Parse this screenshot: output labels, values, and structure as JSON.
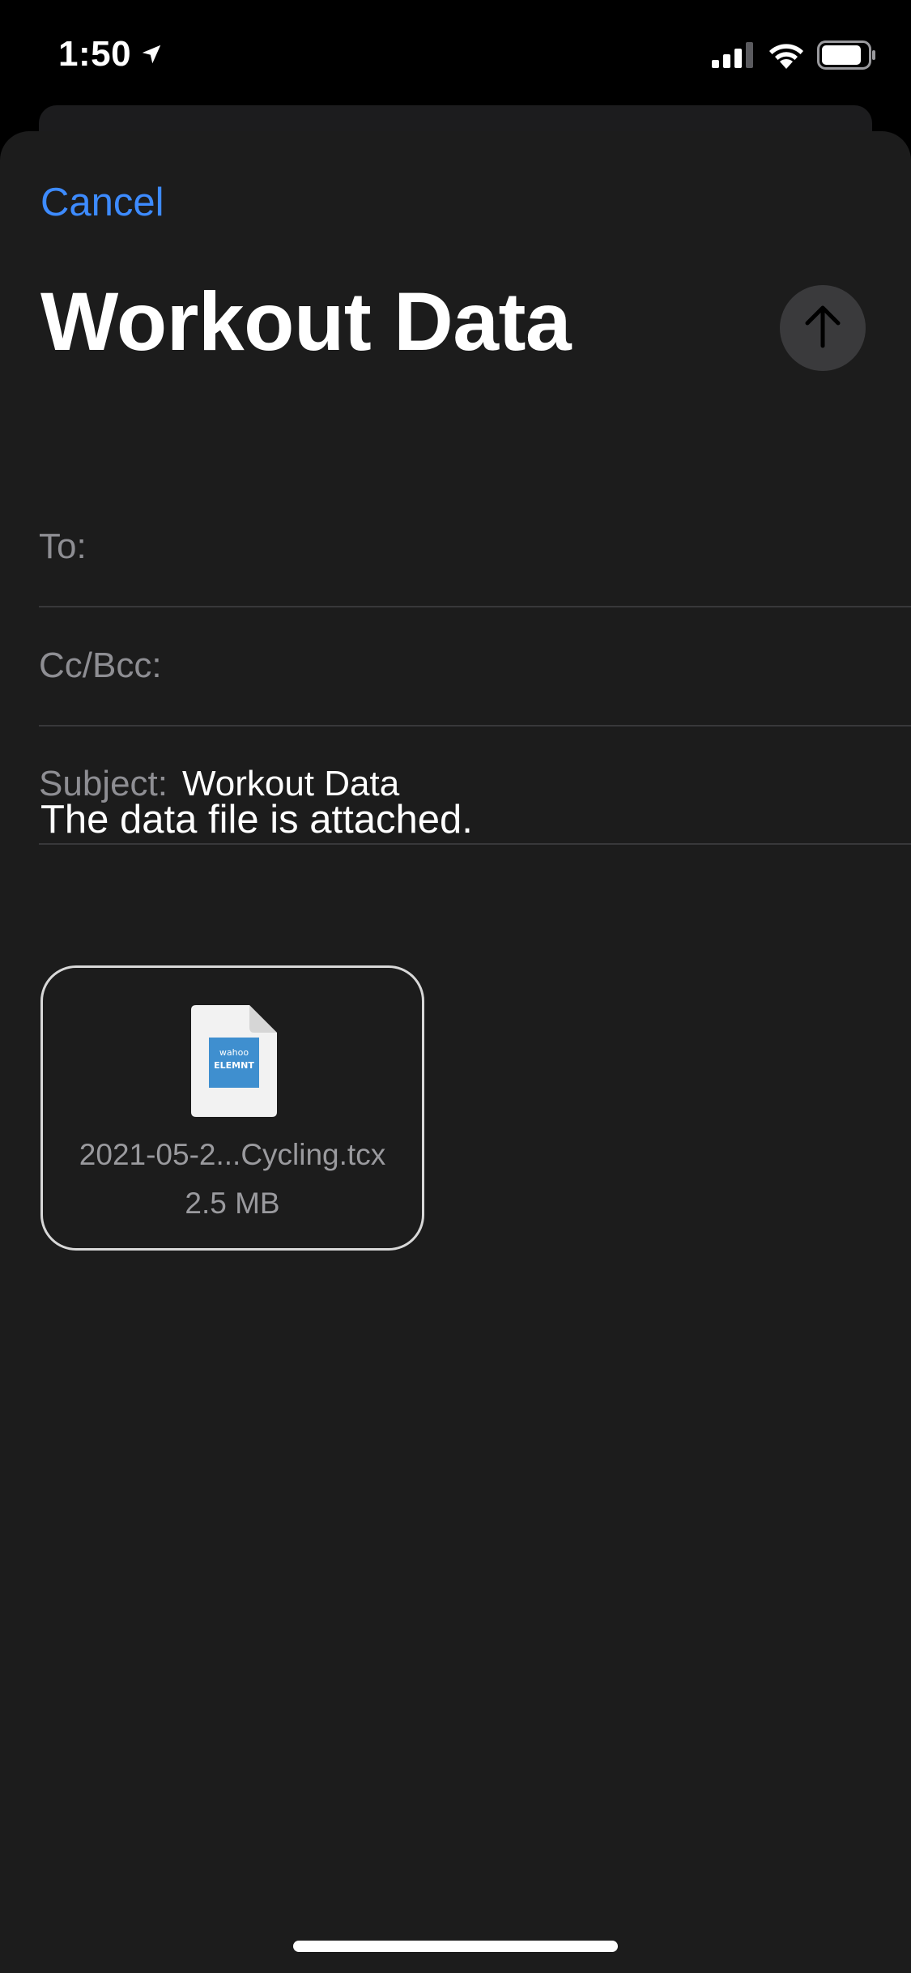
{
  "status_bar": {
    "time": "1:50",
    "location_icon": "location-arrow-icon",
    "signal_icon": "cellular-signal-icon",
    "wifi_icon": "wifi-icon",
    "battery_icon": "battery-icon"
  },
  "compose": {
    "cancel_label": "Cancel",
    "title": "Workout Data",
    "send_icon": "arrow-up-icon",
    "fields": {
      "to_label": "To:",
      "to_value": "",
      "cc_label": "Cc/Bcc:",
      "cc_value": "",
      "subject_label": "Subject:",
      "subject_value": "Workout Data"
    },
    "body": "The data file is attached.",
    "attachment": {
      "file_name": "2021-05-2...Cycling.tcx",
      "file_size": "2.5 MB",
      "icon_brand_top": "wahoo",
      "icon_brand_bottom": "ELEMNT"
    }
  },
  "colors": {
    "accent": "#3d8bff",
    "sheet_background": "#1c1c1c",
    "secondary_text": "#8e8e93",
    "file_icon_brand": "#3f8fcf"
  }
}
